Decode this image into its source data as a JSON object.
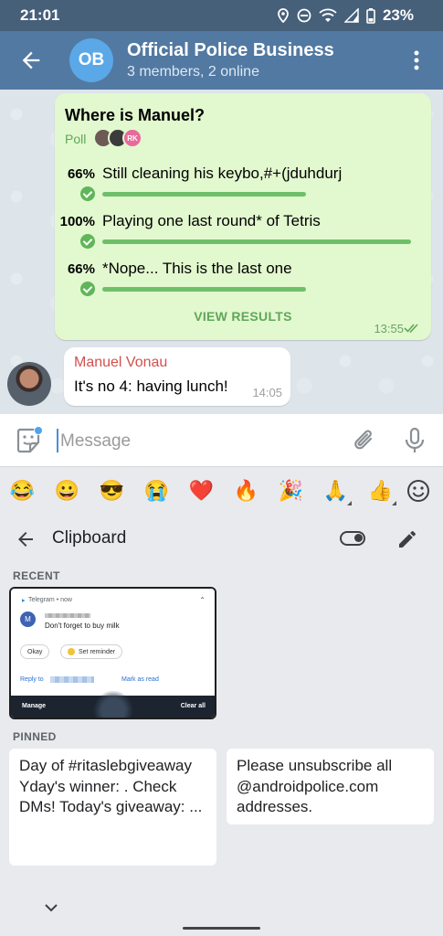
{
  "status_bar": {
    "time": "21:01",
    "battery": "23%",
    "icons": [
      "location-icon",
      "dnd-icon",
      "wifi-icon",
      "signal-icon",
      "battery-icon"
    ]
  },
  "header": {
    "avatar_initials": "OB",
    "title": "Official Police Business",
    "subtitle": "3 members, 2 online",
    "colors": {
      "bar": "#5279a2",
      "avatar": "#5aa8e8"
    }
  },
  "poll": {
    "question": "Where is Manuel?",
    "label": "Poll",
    "voter_badge": "RK",
    "options": [
      {
        "percent": "66%",
        "text": "Still cleaning his keybo,#+(jduhdurj",
        "value": 0.66
      },
      {
        "percent": "100%",
        "text": "Playing one last round* of Tetris",
        "value": 1.0
      },
      {
        "percent": "66%",
        "text": "*Nope... This is the last one",
        "value": 0.66
      }
    ],
    "view_results": "VIEW RESULTS",
    "time": "13:55",
    "bubble_color": "#e2f8cf"
  },
  "message": {
    "author": "Manuel Vonau",
    "text": "It's no 4: having lunch!",
    "time": "14:05",
    "author_color": "#d1514f"
  },
  "input": {
    "placeholder": "Message",
    "value": ""
  },
  "emojis": [
    "😂",
    "😀",
    "😎",
    "😭",
    "❤️",
    "🔥",
    "🎉",
    "🙏",
    "👍"
  ],
  "clipboard": {
    "title": "Clipboard",
    "recent_label": "RECENT",
    "pinned_label": "PINNED",
    "screenshot": {
      "app": "Telegram • now",
      "avatar": "M",
      "line": "Don't forget to buy milk",
      "chip1": "Okay",
      "chip2": "Set reminder",
      "reply": "Reply to",
      "mark": "Mark as read",
      "manage": "Manage",
      "clear_all": "Clear all"
    },
    "pinned": [
      "Day  of #ritaslebgiveaway Yday's winner: . Check DMs! Today's giveaway: ...",
      "Please unsubscribe all @androidpolice.com addresses."
    ]
  }
}
